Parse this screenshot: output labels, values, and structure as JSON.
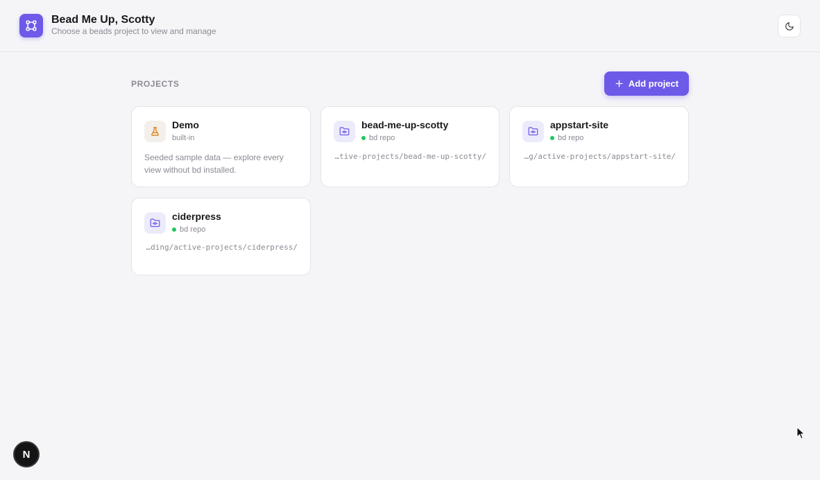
{
  "header": {
    "title": "Bead Me Up, Scotty",
    "subtitle": "Choose a beads project to view and manage",
    "logo_icon": "beads-network-icon",
    "theme_icon": "moon-icon"
  },
  "projects": {
    "section_label": "PROJECTS",
    "add_label": "Add project",
    "cards": [
      {
        "name": "Demo",
        "kind": "built-in",
        "icon": "flask-icon",
        "description": "Seeded sample data — explore every view without bd installed."
      },
      {
        "name": "bead-me-up-scotty",
        "kind": "bd repo",
        "icon": "folder-git-icon",
        "path": "…tive-projects/bead-me-up-scotty/"
      },
      {
        "name": "appstart-site",
        "kind": "bd repo",
        "icon": "folder-git-icon",
        "path": "…g/active-projects/appstart-site/"
      },
      {
        "name": "ciderpress",
        "kind": "bd repo",
        "icon": "folder-git-icon",
        "path": "…ding/active-projects/ciderpress/"
      }
    ]
  },
  "dev_badge": {
    "label": "N"
  },
  "colors": {
    "accent": "#6d5ae8",
    "status_green": "#22c55e",
    "background": "#f5f5f8",
    "demo_icon": "#d97706"
  }
}
